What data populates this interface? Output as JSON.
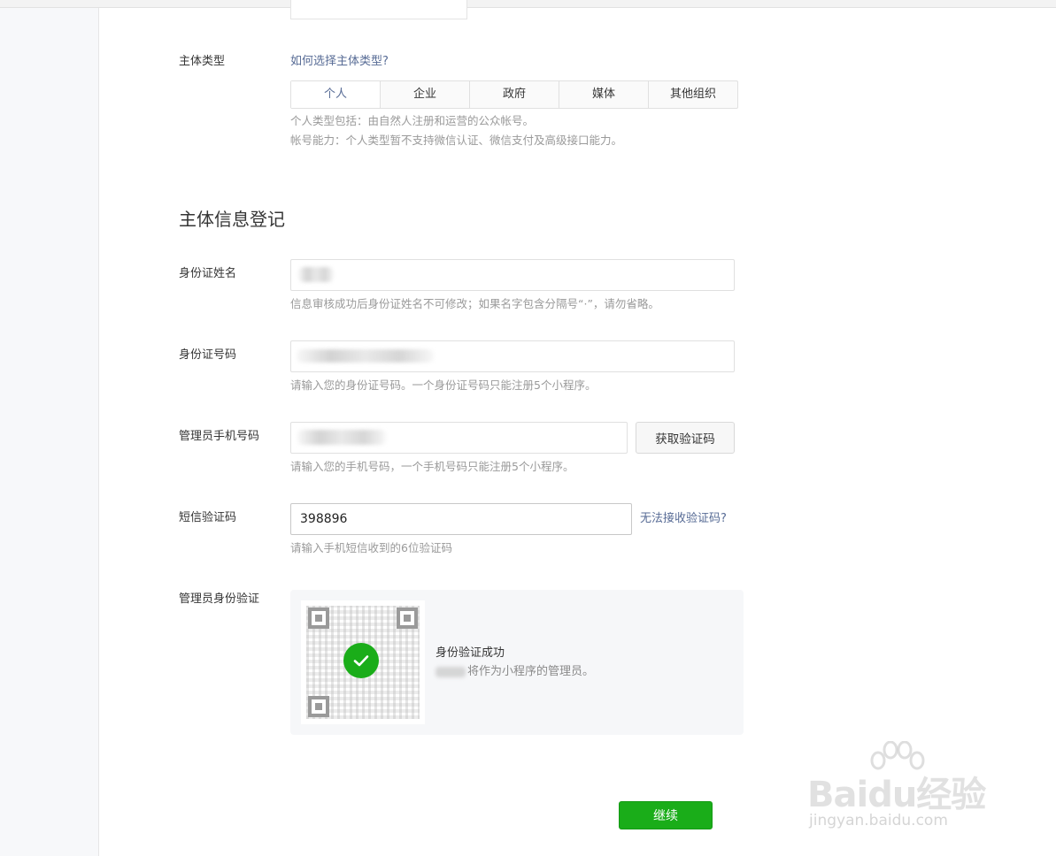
{
  "subject_type": {
    "label": "主体类型",
    "help_link": "如何选择主体类型?",
    "options": [
      "个人",
      "企业",
      "政府",
      "媒体",
      "其他组织"
    ],
    "selected": "个人",
    "tip_line1": "个人类型包括：由自然人注册和运营的公众帐号。",
    "tip_line2": "帐号能力：个人类型暂不支持微信认证、微信支付及高级接口能力。"
  },
  "section_title": "主体信息登记",
  "id_name": {
    "label": "身份证姓名",
    "tip": "信息审核成功后身份证姓名不可修改；如果名字包含分隔号“·”，请勿省略。"
  },
  "id_number": {
    "label": "身份证号码",
    "tip": "请输入您的身份证号码。一个身份证号码只能注册5个小程序。"
  },
  "admin_phone": {
    "label": "管理员手机号码",
    "get_code_button": "获取验证码",
    "tip": "请输入您的手机号码，一个手机号码只能注册5个小程序。"
  },
  "sms_code": {
    "label": "短信验证码",
    "value": "398896",
    "help_link": "无法接收验证码?",
    "tip": "请输入手机短信收到的6位验证码"
  },
  "admin_verify": {
    "label": "管理员身份验证",
    "status_title": "身份验证成功",
    "status_desc": "将作为小程序的管理员。"
  },
  "continue_button": "继续",
  "watermark": {
    "brand": "Baidu经验",
    "url": "jingyan.baidu.com"
  },
  "colors": {
    "accent_green": "#1aad19",
    "link_blue": "#576b95"
  }
}
